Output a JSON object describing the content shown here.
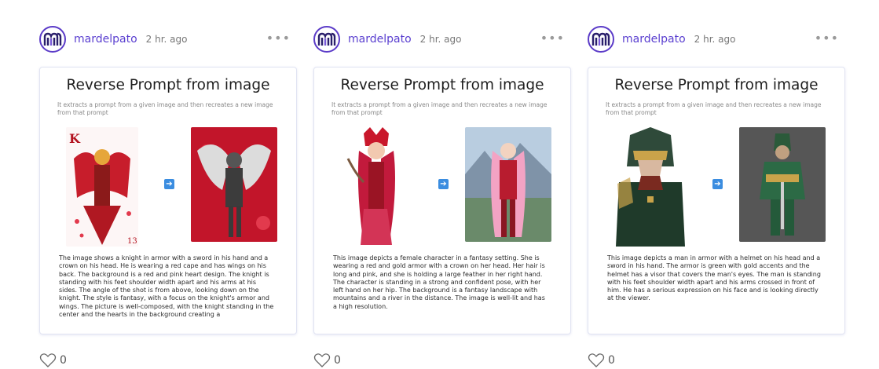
{
  "posts": [
    {
      "username": "mardelpato",
      "timestamp": "2 hr. ago",
      "more": "•••",
      "title": "Reverse Prompt from image",
      "subtitle": "It extracts a prompt from a given image and then recreates a new image from that prompt",
      "description": "The image shows a knight in armor with a sword in his hand and a crown on his head. He is wearing a red cape and has wings on his back. The background is a red and pink heart design. The knight is standing with his feet shoulder width apart and his arms at his sides. The angle of the shot is from above, looking down on the knight. The style is fantasy, with a focus on the knight's armor and wings. The picture is well-composed, with the knight standing in the center and the hearts in the background creating a",
      "likes": "0",
      "left_image": "king-of-hearts-knight-card",
      "right_image": "winged-armored-knight-on-red-hearts"
    },
    {
      "username": "mardelpato",
      "timestamp": "2 hr. ago",
      "more": "•••",
      "title": "Reverse Prompt from image",
      "subtitle": "It extracts a prompt from a given image and then recreates a new image from that prompt",
      "description": "This image depicts a female character in a fantasy setting. She is wearing a red and gold armor with a crown on her head. Her hair is long and pink, and she is holding a large feather in her right hand. The character is standing in a strong and confident pose, with her left hand on her hip. The background is a fantasy landscape with mountains and a river in the distance. The image is well-lit and has a high resolution.",
      "likes": "0",
      "left_image": "crowned-female-warrior-pink-hair",
      "right_image": "pink-haired-warrior-mountain-landscape"
    },
    {
      "username": "mardelpato",
      "timestamp": "2 hr. ago",
      "more": "•••",
      "title": "Reverse Prompt from image",
      "subtitle": "It extracts a prompt from a given image and then recreates a new image from that prompt",
      "description": "This image depicts a man in armor with a helmet on his head and a sword in his hand. The armor is green with gold accents and the helmet has a visor that covers the man's eyes. The man is standing with his feet shoulder width apart and his arms crossed in front of him. He has a serious expression on his face and is looking directly at the viewer.",
      "likes": "0",
      "left_image": "green-armored-knight-portrait",
      "right_image": "green-armored-knight-full-body"
    }
  ],
  "colors": {
    "accent": "#5a3fd0",
    "arrow": "#3b8de0"
  }
}
